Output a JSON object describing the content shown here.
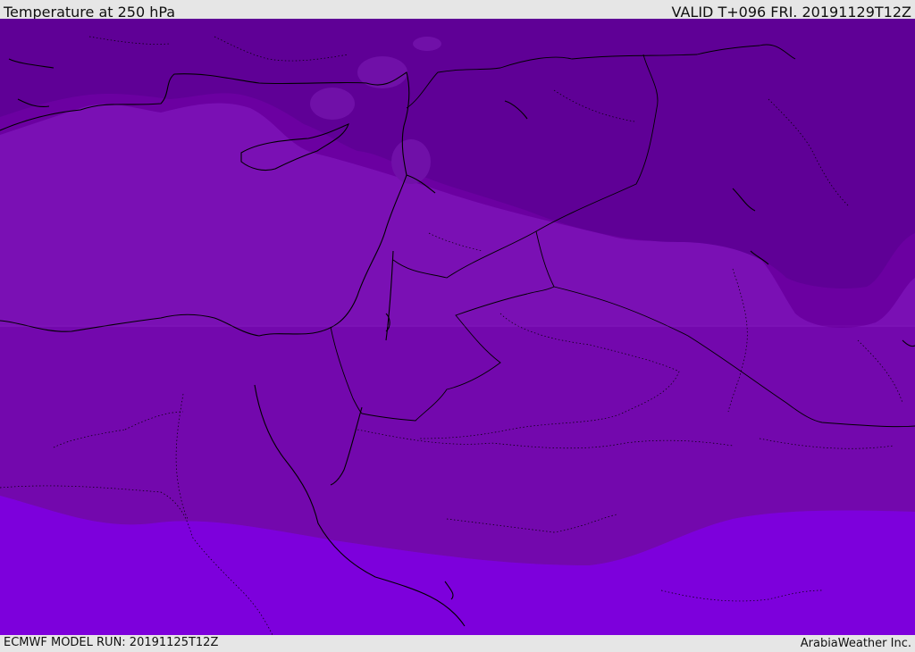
{
  "header": {
    "title": "Temperature at 250 hPa",
    "valid": "VALID T+096 FRI. 20191129T12Z"
  },
  "footer": {
    "model_run": "ECMWF MODEL RUN: 20191125T12Z",
    "brand": "ArabiaWeather Inc."
  },
  "map": {
    "field": "temperature",
    "level": "250 hPa",
    "band_colors": {
      "coldest": "#5f0096",
      "cold": "#6b00a1",
      "mid": "#7a10b4",
      "warmer": "#7308ad",
      "warmest": "#7d00dc"
    },
    "coastline_color": "#000000"
  }
}
